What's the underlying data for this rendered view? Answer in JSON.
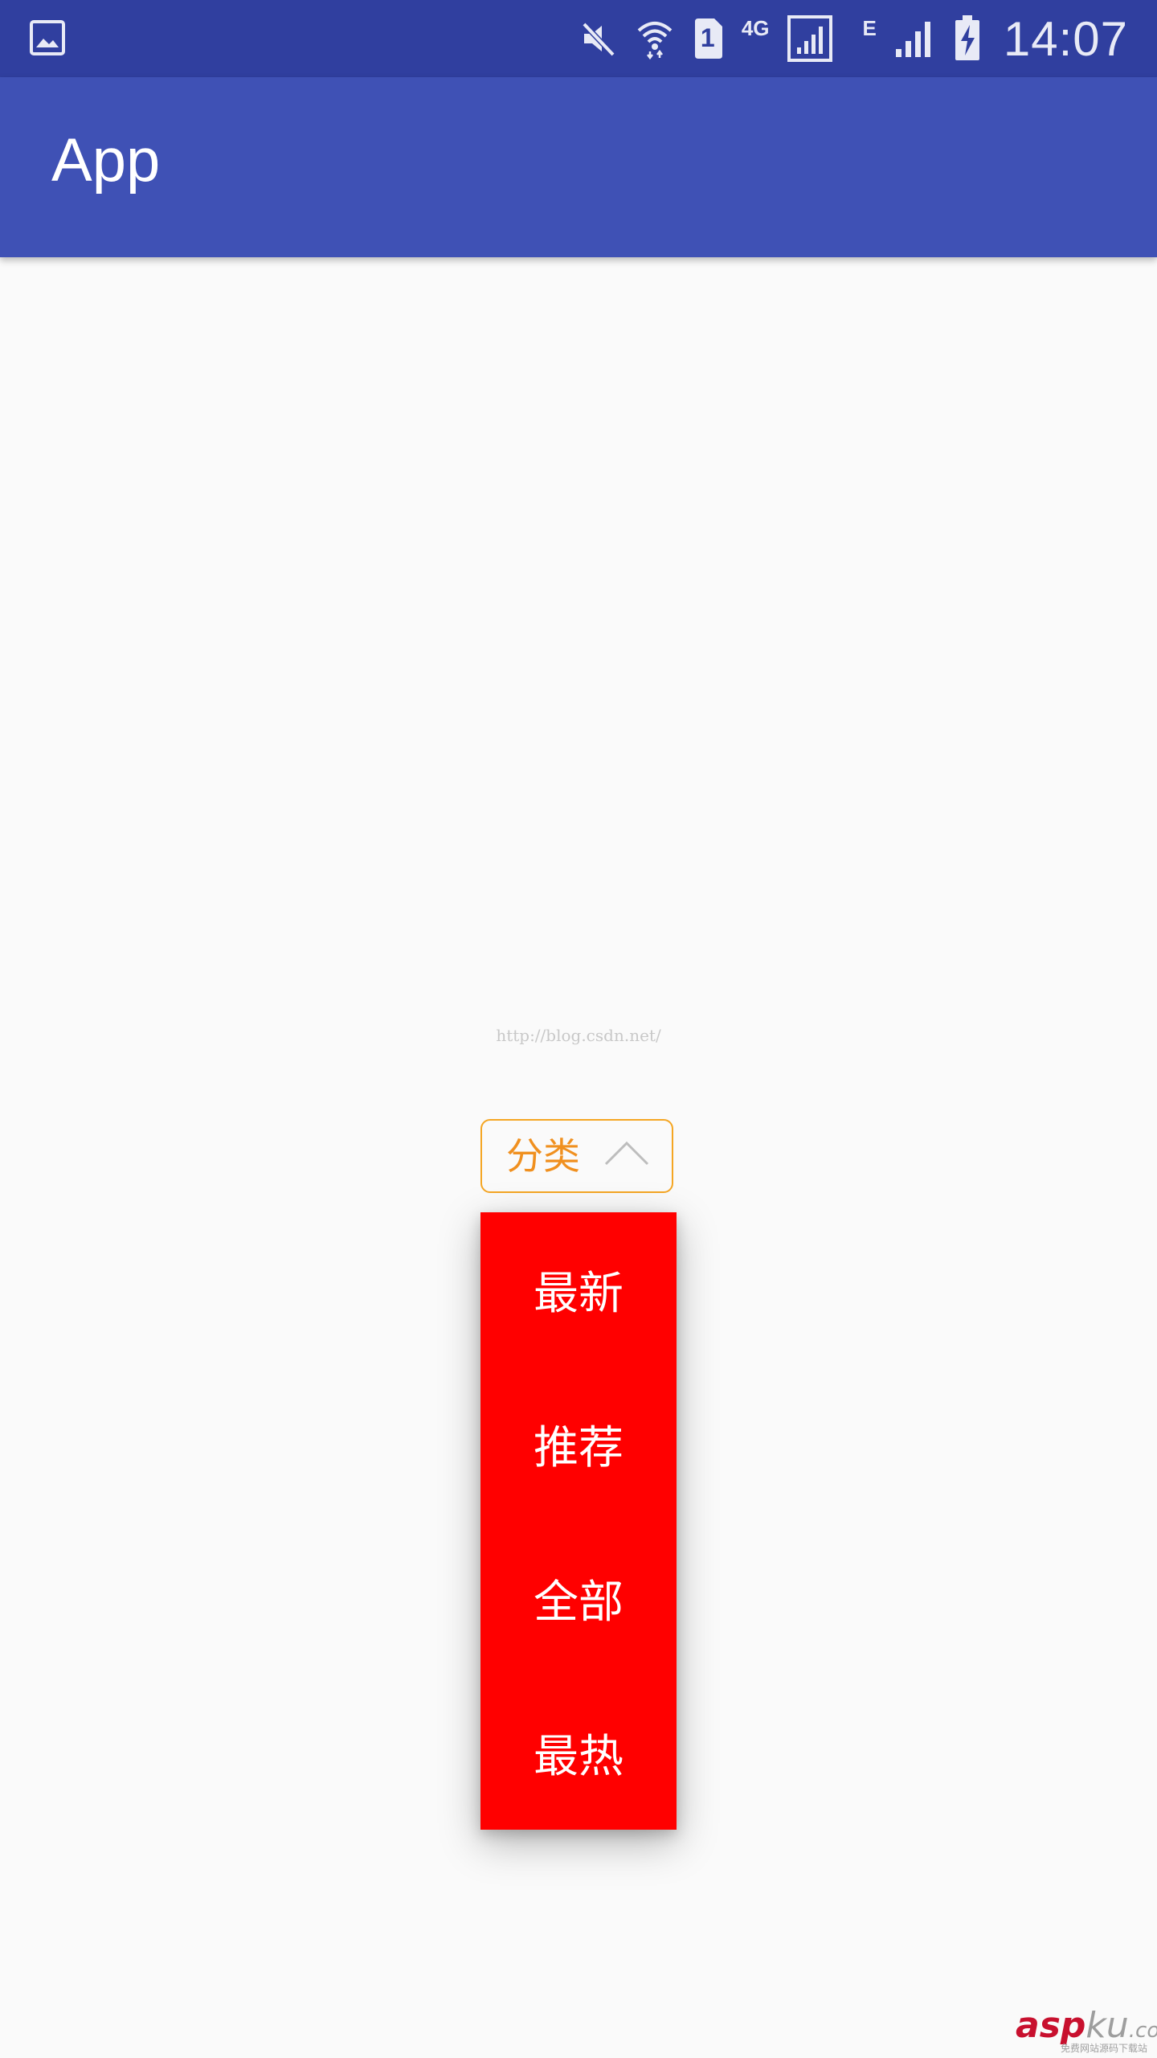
{
  "status_bar": {
    "network_label": "4G",
    "sim_label": "1",
    "edge_label": "E",
    "time": "14:07",
    "icons": [
      "image-icon",
      "mute-icon",
      "wifi-icon",
      "sim-icon",
      "signal-icon",
      "signal-icon",
      "battery-charging-icon"
    ]
  },
  "app_bar": {
    "title": "App"
  },
  "watermark": {
    "url": "http://blog.csdn.net/"
  },
  "spinner": {
    "label": "分类",
    "accent_color": "#f5a623",
    "arrow_icon": "chevron-up-icon"
  },
  "dropdown": {
    "background": "#ff0000",
    "items": [
      {
        "label": "最新"
      },
      {
        "label": "推荐"
      },
      {
        "label": "全部"
      },
      {
        "label": "最热"
      }
    ]
  },
  "site_logo": {
    "part1": "asp",
    "part2": "ku",
    "part3": ".com",
    "tagline": "免费网站源码下载站"
  }
}
